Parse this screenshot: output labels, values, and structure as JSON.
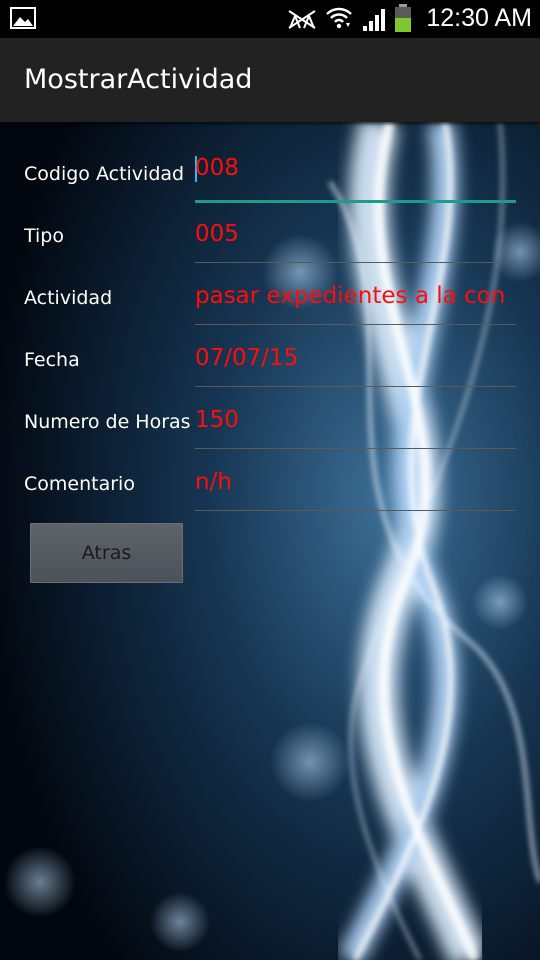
{
  "status_bar": {
    "time": "12:30 AM",
    "icons": [
      "gallery-icon",
      "no-signal-icon",
      "wifi-icon",
      "cell-signal-icon",
      "battery-icon"
    ],
    "battery_color": "#7ec82e"
  },
  "action_bar": {
    "title": "MostrarActividad"
  },
  "form": {
    "fields": [
      {
        "label": "Codigo Actividad",
        "value": "008"
      },
      {
        "label": "Tipo",
        "value": "005"
      },
      {
        "label": "Actividad",
        "value": "pasar expedientes a la con"
      },
      {
        "label": "Fecha",
        "value": "07/07/15"
      },
      {
        "label": "Numero de Horas",
        "value": "150"
      },
      {
        "label": "Comentario",
        "value": "n/h"
      }
    ],
    "back_button_label": "Atras"
  },
  "colors": {
    "value_text": "#ff0d0d",
    "focus_underline": "#1a9e8a",
    "caret": "#35b5e8",
    "action_bar": "#222222"
  }
}
